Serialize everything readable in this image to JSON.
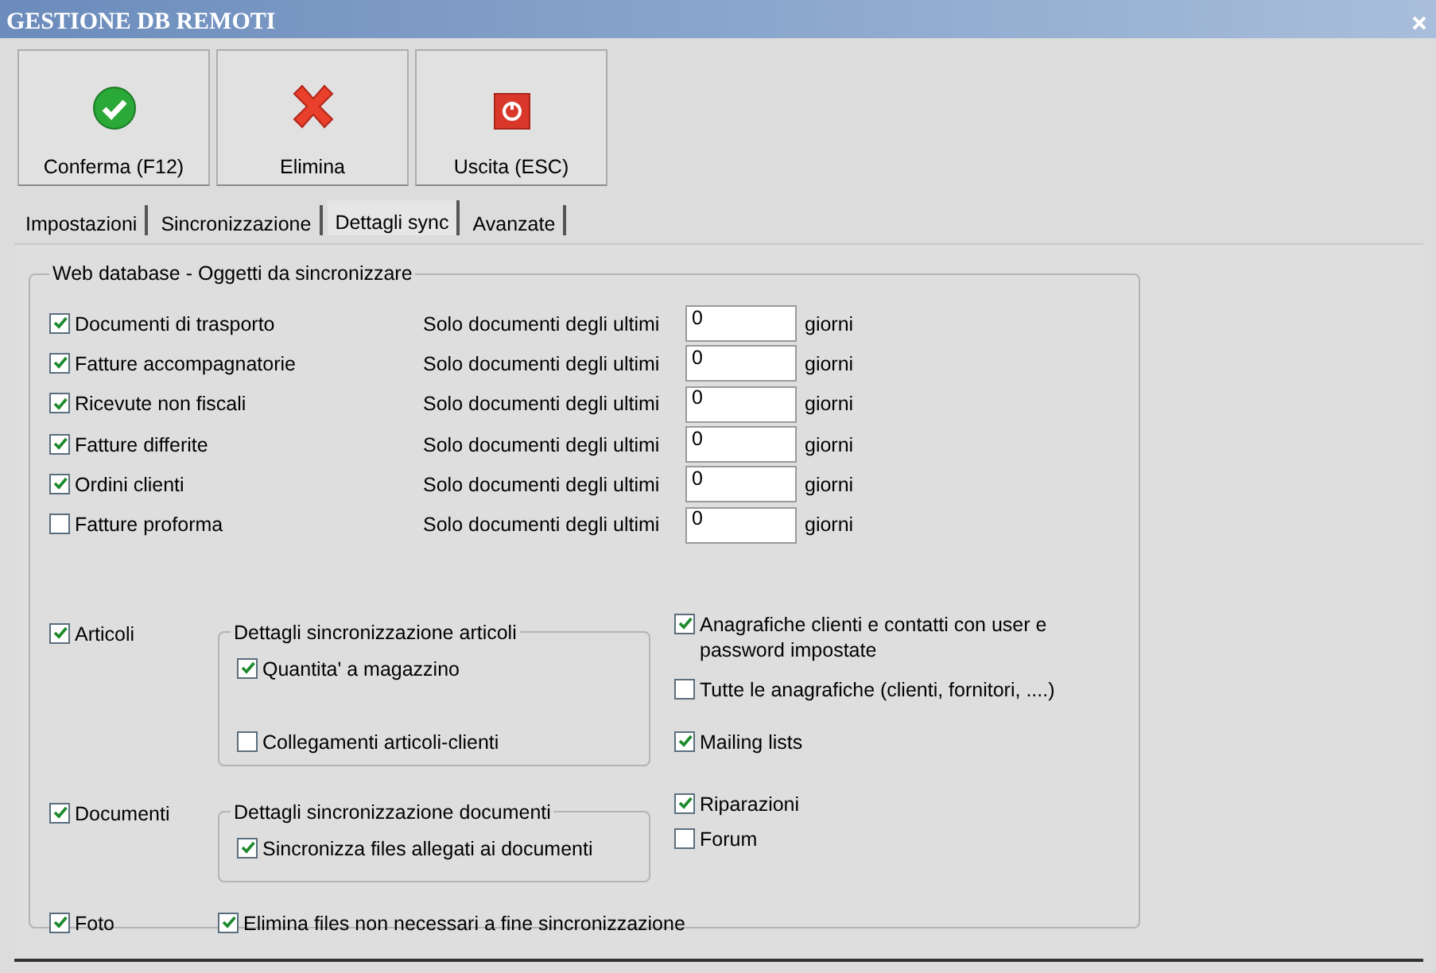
{
  "window": {
    "title": "GESTIONE DB REMOTI"
  },
  "toolbar": [
    {
      "label": "Conferma (F12)",
      "kind": "confirm"
    },
    {
      "label": "Elimina",
      "kind": "delete"
    },
    {
      "label": "Uscita (ESC)",
      "kind": "exit"
    }
  ],
  "tabs": [
    {
      "label": "Impostazioni",
      "selected": false
    },
    {
      "label": "Sincronizzazione",
      "selected": false
    },
    {
      "label": "Dettagli sync",
      "selected": true
    },
    {
      "label": "Avanzate",
      "selected": false
    }
  ],
  "group": {
    "title": "Web database - Oggetti da sincronizzare",
    "documents": [
      {
        "label": "Documenti di trasporto",
        "checked": true,
        "prefix": "Solo documenti degli ultimi",
        "value": "0",
        "suffix": "giorni"
      },
      {
        "label": "Fatture accompagnatorie",
        "checked": true,
        "prefix": "Solo documenti degli ultimi",
        "value": "0",
        "suffix": "giorni"
      },
      {
        "label": "Ricevute non fiscali",
        "checked": true,
        "prefix": "Solo documenti degli ultimi",
        "value": "0",
        "suffix": "giorni"
      },
      {
        "label": "Fatture differite",
        "checked": true,
        "prefix": "Solo documenti degli ultimi",
        "value": "0",
        "suffix": "giorni"
      },
      {
        "label": "Ordini clienti",
        "checked": true,
        "prefix": "Solo documenti degli ultimi",
        "value": "0",
        "suffix": "giorni"
      },
      {
        "label": "Fatture proforma",
        "checked": false,
        "prefix": "Solo documenti degli ultimi",
        "value": "0",
        "suffix": "giorni"
      }
    ],
    "sections": [
      {
        "label": "Articoli",
        "checked": true,
        "details": {
          "title": "Dettagli sincronizzazione articoli",
          "options": [
            {
              "label": "Quantita' a magazzino",
              "checked": true
            },
            {
              "label": "Collegamenti articoli-clienti",
              "checked": false
            }
          ]
        },
        "extras": [
          {
            "label": "Anagrafiche clienti e contatti con user e password impostate",
            "checked": true
          },
          {
            "label": "Tutte le anagrafiche (clienti, fornitori, ....)",
            "checked": false
          },
          {
            "label": "Mailing lists",
            "checked": true
          }
        ]
      },
      {
        "label": "Documenti",
        "checked": true,
        "details": {
          "title": "Dettagli sincronizzazione documenti",
          "options": [
            {
              "label": "Sincronizza files allegati ai documenti",
              "checked": true
            }
          ]
        },
        "extras": [
          {
            "label": "Riparazioni",
            "checked": true
          },
          {
            "label": "Forum",
            "checked": false
          }
        ]
      }
    ],
    "photos": {
      "label": "Foto",
      "checked": true
    },
    "cleanup": {
      "label": "Elimina files non necessari a fine sincronizzazione",
      "checked": true
    }
  }
}
